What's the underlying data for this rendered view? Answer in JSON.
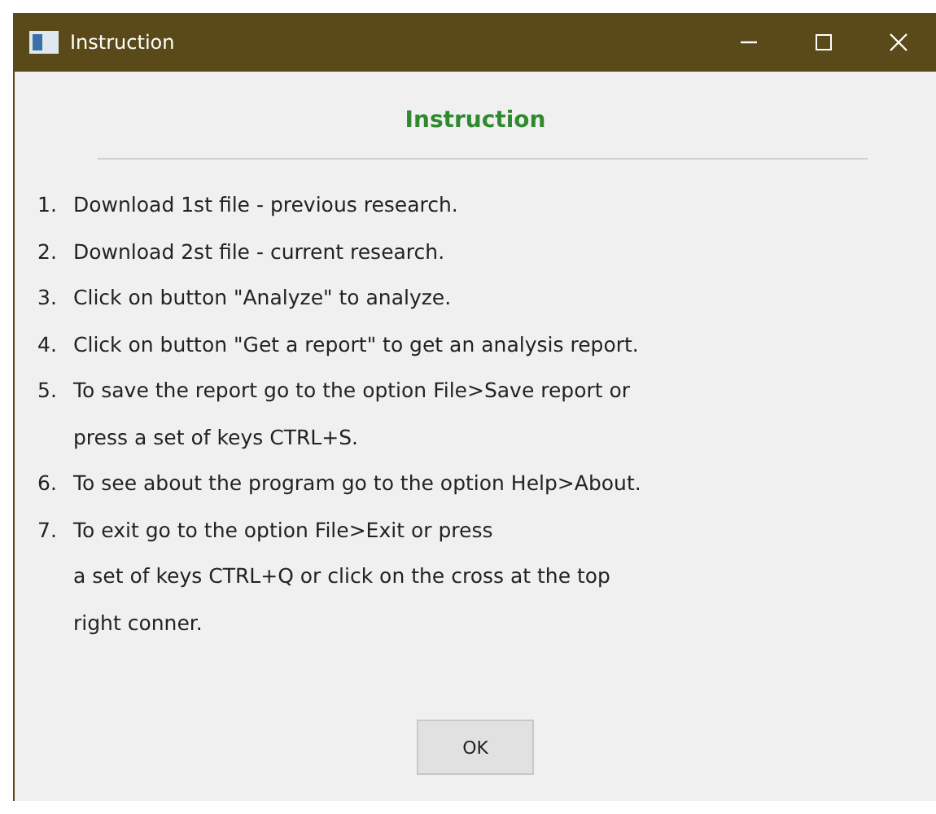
{
  "window": {
    "title": "Instruction"
  },
  "heading": "Instruction",
  "steps": [
    {
      "number": "1.",
      "lines": [
        "Download 1st file - previous research."
      ]
    },
    {
      "number": "2.",
      "lines": [
        "Download 2st file - current research."
      ]
    },
    {
      "number": "3.",
      "lines": [
        "Click on button \"Analyze\" to analyze."
      ]
    },
    {
      "number": "4.",
      "lines": [
        "Click on button \"Get a report\" to get an analysis report."
      ]
    },
    {
      "number": "5.",
      "lines": [
        "To save the report go to the option File>Save report or",
        "press a set of keys CTRL+S."
      ]
    },
    {
      "number": "6.",
      "lines": [
        "To see about the program go to the option Help>About."
      ]
    },
    {
      "number": "7.",
      "lines": [
        "To exit go to the option File>Exit or press",
        "a set of keys CTRL+Q or click on the cross at the top",
        "right conner."
      ]
    }
  ],
  "buttons": [
    "OK"
  ]
}
